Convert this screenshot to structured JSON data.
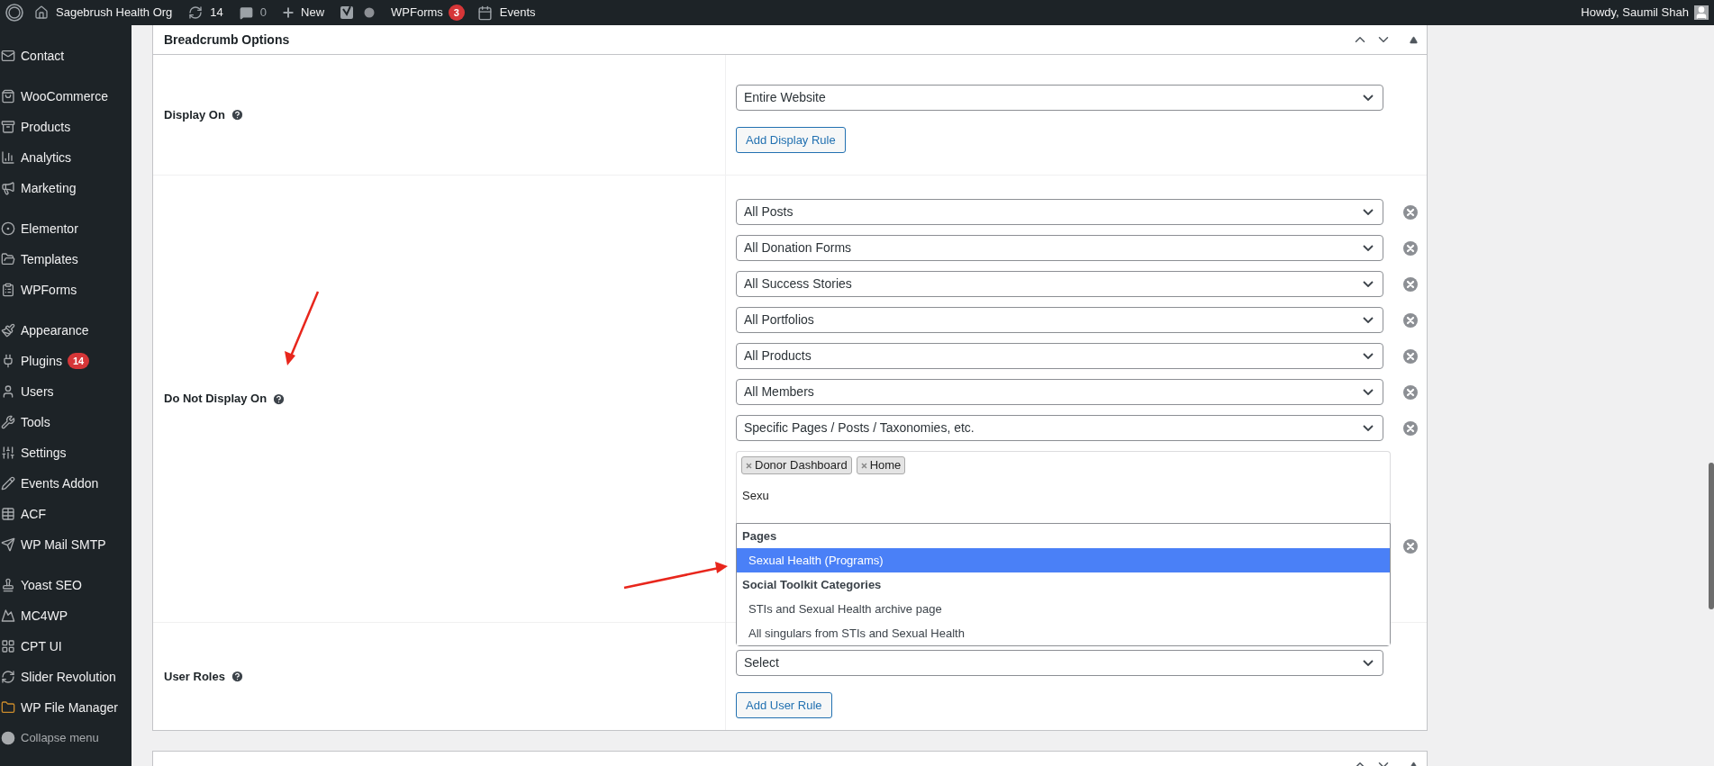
{
  "admin_bar": {
    "site": "Sagebrush Health Org",
    "updates": "14",
    "comments": "0",
    "new": "New",
    "forms": {
      "label": "WPForms",
      "badge": "3"
    },
    "events": "Events",
    "greeting": "Howdy, Saumil Shah"
  },
  "sidebar": {
    "groups": [
      [
        {
          "label": "Contact"
        }
      ],
      [
        {
          "label": "WooCommerce"
        },
        {
          "label": "Products"
        },
        {
          "label": "Analytics"
        },
        {
          "label": "Marketing"
        }
      ],
      [
        {
          "label": "Elementor"
        },
        {
          "label": "Templates"
        },
        {
          "label": "WPForms"
        }
      ],
      [
        {
          "label": "Appearance"
        },
        {
          "label": "Plugins",
          "badge": "14"
        },
        {
          "label": "Users"
        },
        {
          "label": "Tools"
        },
        {
          "label": "Settings"
        },
        {
          "label": "Events Addon"
        },
        {
          "label": "ACF"
        },
        {
          "label": "WP Mail SMTP"
        }
      ],
      [
        {
          "label": "Yoast SEO"
        },
        {
          "label": "MC4WP"
        },
        {
          "label": "CPT UI"
        },
        {
          "label": "Slider Revolution"
        },
        {
          "label": "WP File Manager"
        }
      ]
    ],
    "collapse": "Collapse menu"
  },
  "panel": {
    "title": "Breadcrumb Options",
    "rows": [
      {
        "label": "Display On",
        "rules": [
          {
            "kind": "select",
            "value": "Entire Website",
            "removable": false
          }
        ],
        "button": "Add Display Rule"
      },
      {
        "label": "Do Not Display On",
        "rules": [
          {
            "kind": "select",
            "value": "All Posts",
            "removable": true
          },
          {
            "kind": "select",
            "value": "All Donation Forms",
            "removable": true
          },
          {
            "kind": "select",
            "value": "All Success Stories",
            "removable": true
          },
          {
            "kind": "select",
            "value": "All Portfolios",
            "removable": true
          },
          {
            "kind": "select",
            "value": "All Products",
            "removable": true
          },
          {
            "kind": "select",
            "value": "All Members",
            "removable": true
          },
          {
            "kind": "select",
            "value": "Specific Pages / Posts / Taxonomies, etc.",
            "removable": true
          },
          {
            "kind": "multiselect",
            "removable": true,
            "tags": [
              "Donor Dashboard",
              "Home"
            ],
            "query": "Sexu",
            "dropdown": [
              {
                "kind": "group",
                "label": "Pages"
              },
              {
                "kind": "option",
                "label": "Sexual Health (Programs)",
                "selected": true
              },
              {
                "kind": "group",
                "label": "Social Toolkit Categories"
              },
              {
                "kind": "option",
                "label": "STIs and Sexual Health archive page",
                "selected": false
              },
              {
                "kind": "option",
                "label": "All singulars from STIs and Sexual Health",
                "selected": false
              }
            ]
          }
        ]
      },
      {
        "label": "User Roles",
        "rules": [
          {
            "kind": "select",
            "value": "Select",
            "removable": false
          }
        ],
        "button": "Add User Rule"
      }
    ]
  }
}
